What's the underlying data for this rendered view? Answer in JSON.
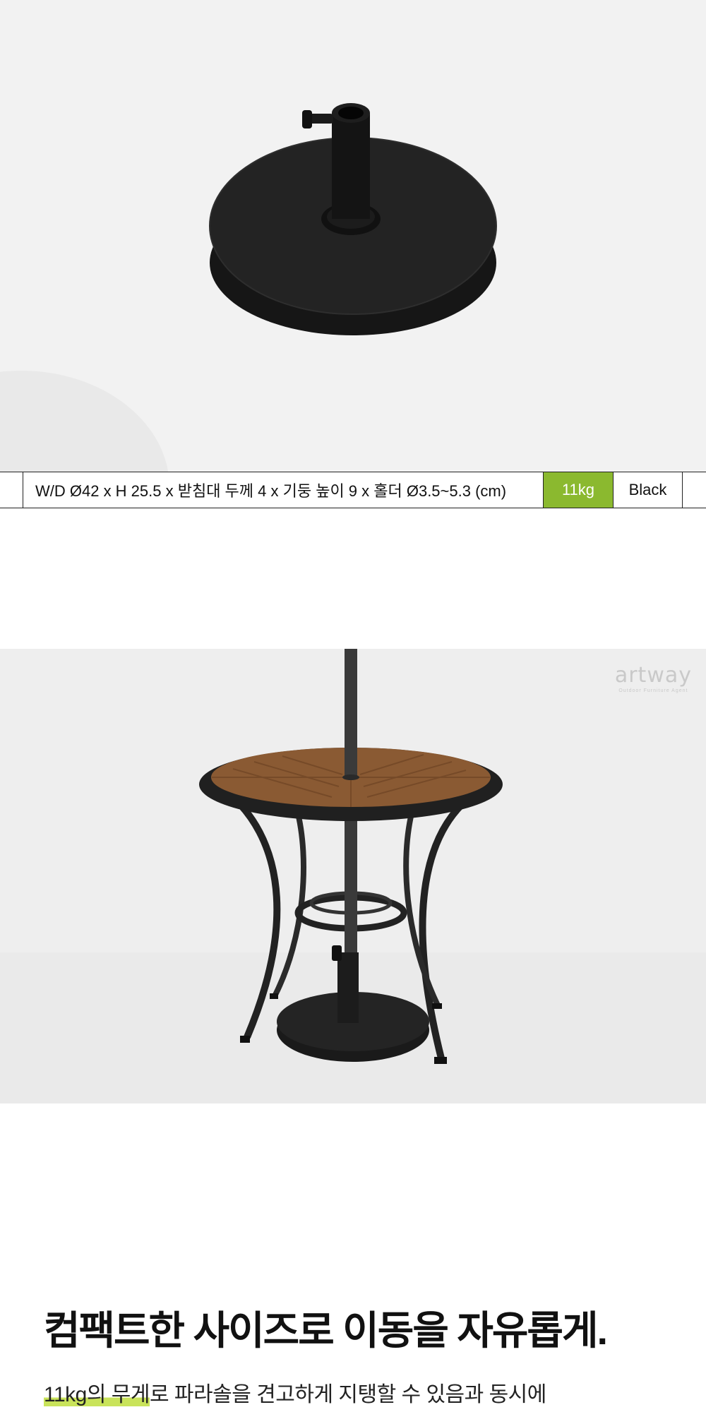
{
  "spec": {
    "dimensions": "W/D Ø42 x H 25.5 x 받침대 두께 4 x 기둥 높이 9 x 홀더 Ø3.5~5.3 (cm)",
    "weight": "11kg",
    "color_name": "Black",
    "weight_badge_color": "#8bb92f"
  },
  "watermark": {
    "name": "artway",
    "tagline": "Outdoor Furniture Agent"
  },
  "copy": {
    "headline": "컴팩트한 사이즈로 이동을 자유롭게.",
    "body_highlight": "11kg의 무게",
    "body_rest": "로 파라솔을 견고하게 지탱할 수 있음과 동시에"
  }
}
